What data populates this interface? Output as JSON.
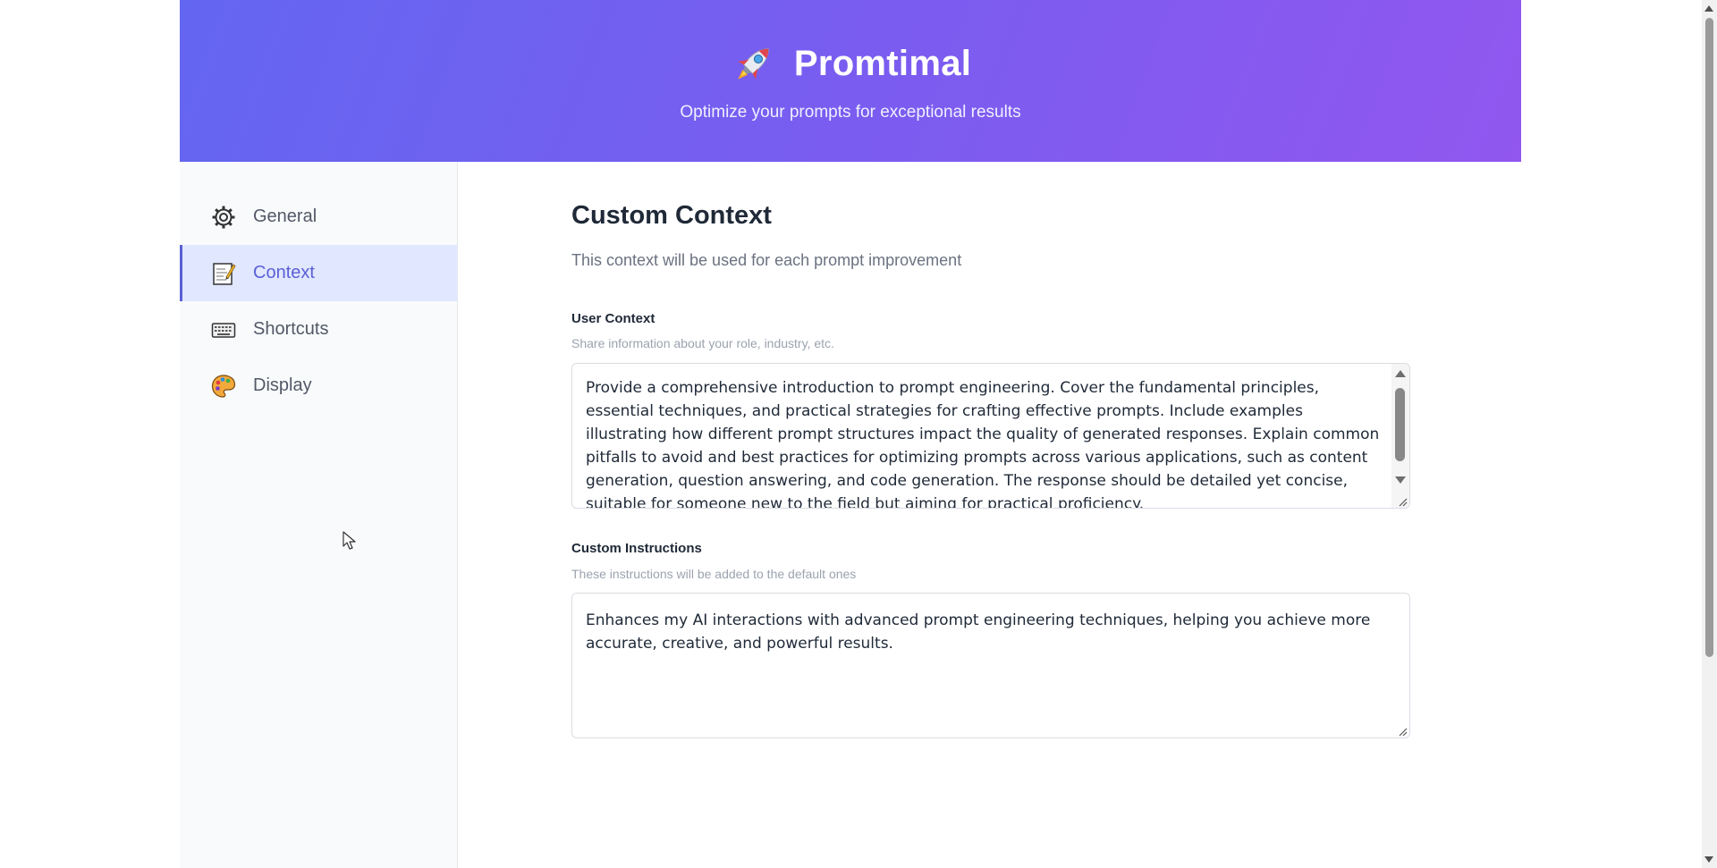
{
  "header": {
    "title": "Promtimal",
    "subtitle": "Optimize your prompts for exceptional results",
    "logo_icon": "rocket-icon"
  },
  "sidebar": {
    "items": [
      {
        "label": "General",
        "icon": "gear-icon",
        "active": false
      },
      {
        "label": "Context",
        "icon": "memo-icon",
        "active": true
      },
      {
        "label": "Shortcuts",
        "icon": "keyboard-icon",
        "active": false
      },
      {
        "label": "Display",
        "icon": "palette-icon",
        "active": false
      }
    ]
  },
  "main": {
    "title": "Custom Context",
    "description": "This context will be used for each prompt improvement",
    "user_context": {
      "label": "User Context",
      "hint": "Share information about your role, industry, etc.",
      "value": "Provide a comprehensive introduction to prompt engineering. Cover the fundamental principles, essential techniques, and practical strategies for crafting effective prompts. Include examples illustrating how different prompt structures impact the quality of generated responses. Explain common pitfalls to avoid and best practices for optimizing prompts across various applications, such as content generation, question answering, and code generation. The response should be detailed yet concise, suitable for someone new to the field but aiming for practical proficiency."
    },
    "custom_instructions": {
      "label": "Custom Instructions",
      "hint": "These instructions will be added to the default ones",
      "value": "Enhances my AI interactions with advanced prompt engineering techniques, helping you achieve more accurate, creative, and powerful results."
    }
  },
  "colors": {
    "header_gradient_start": "#6366f1",
    "header_gradient_end": "#9157ef",
    "active_accent": "#5b5fd6",
    "active_bg": "#e0e7ff"
  }
}
